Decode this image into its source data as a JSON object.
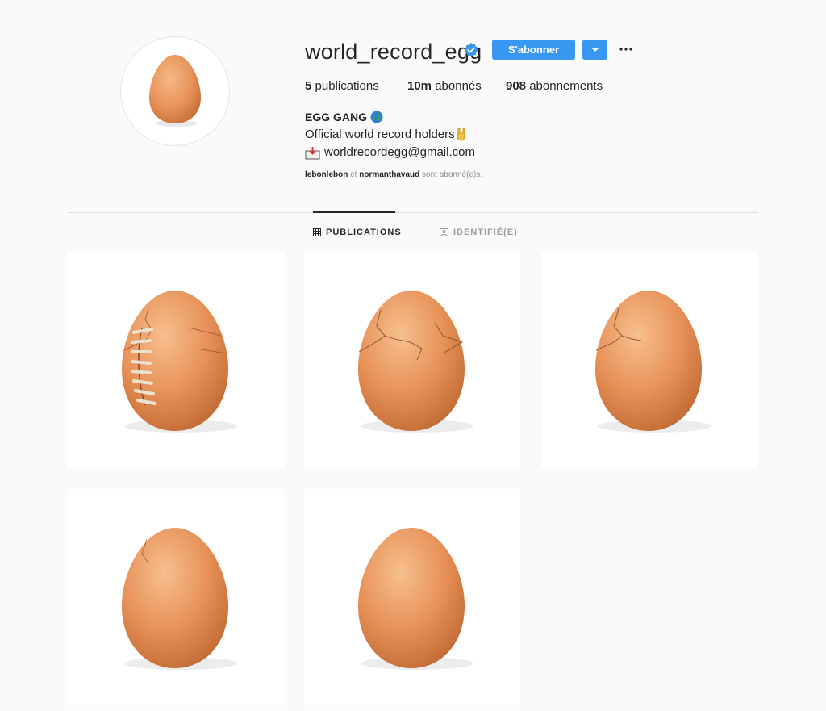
{
  "profile": {
    "username": "world_record_egg",
    "follow_label": "S'abonner",
    "stats": [
      {
        "value": "5",
        "label": "publications"
      },
      {
        "value": "10m",
        "label": "abonnés"
      },
      {
        "value": "908",
        "label": "abonnements"
      }
    ],
    "full_name": "EGG GANG",
    "bio_line": "Official world record holders",
    "email": "worldrecordegg@gmail.com",
    "followed_by": {
      "user1": "lebonlebon",
      "connector": "et",
      "user2": "normanthavaud",
      "suffix": "sont abonné(e)s."
    }
  },
  "tabs": [
    {
      "label": "PUBLICATIONS",
      "icon": "grid-icon",
      "active": true
    },
    {
      "label": "IDENTIFIÉ(E)",
      "icon": "tagged-icon",
      "active": false
    }
  ],
  "posts": [
    {
      "variant": "football-egg"
    },
    {
      "variant": "heavily-cracked-egg"
    },
    {
      "variant": "cracked-egg"
    },
    {
      "variant": "lightly-cracked-egg"
    },
    {
      "variant": "plain-egg"
    }
  ],
  "colors": {
    "accent": "#3897f0",
    "egg": "#e8935a",
    "background": "#fafafa"
  }
}
